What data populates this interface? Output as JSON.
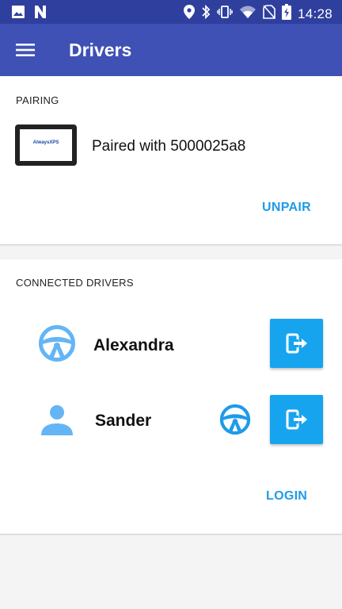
{
  "status_bar": {
    "time": "14:28"
  },
  "app_bar": {
    "title": "Drivers"
  },
  "pairing": {
    "section_label": "PAIRING",
    "device_logo_text": "AlwaysXPS",
    "paired_text": "Paired with 5000025a8",
    "unpair_label": "UNPAIR"
  },
  "drivers": {
    "section_label": "CONNECTED DRIVERS",
    "items": [
      {
        "name": "Alexandra",
        "role_icon": "steering-wheel-icon"
      },
      {
        "name": "Sander",
        "role_icon": "person-icon",
        "secondary_icon": "steering-wheel-icon"
      }
    ],
    "login_label": "LOGIN"
  },
  "colors": {
    "status_bar": "#2e3f9e",
    "app_bar": "#3f51b5",
    "accent": "#1e9be9",
    "logout_button": "#17a4ef",
    "driver_icon": "#64b5f6",
    "steering_icon_small": "#1e9be9"
  }
}
